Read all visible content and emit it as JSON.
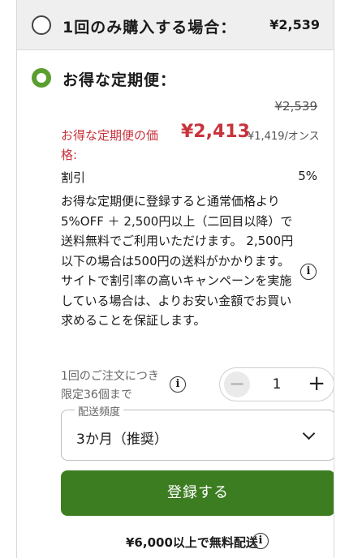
{
  "one_time": {
    "label": "1回のみ購入する場合：",
    "price": "¥2,539"
  },
  "subscription": {
    "label": "お得な定期便：",
    "original_price": "¥2,539",
    "price_label": "お得な定期便の価格:",
    "price": "¥2,413",
    "unit_price": "¥1,419/オンス",
    "discount_label": "割引",
    "discount_value": "5%",
    "description": "お得な定期便に登録すると通常価格より5%OFF ＋ 2,500円以上（二回目以降）で送料無料でご利用いただけます。 2,500円以下の場合は500円の送料がかかります。サイトで割引率の高いキャンペーンを実施している場合は、よりお安い金額でお買い求めることを保証します。"
  },
  "quantity": {
    "limit_text": "1回のご注文につき限定36個まで",
    "value": "1",
    "minus": "−",
    "plus": "+"
  },
  "frequency": {
    "legend": "配送頻度",
    "selected": "3か月（推奨）"
  },
  "register_button": "登録する",
  "free_shipping": "¥6,000以上で無料配送",
  "icons": {
    "info": "i"
  },
  "colors": {
    "accent_green": "#3d7d22",
    "radio_green": "#5a9e2f",
    "price_red": "#c7333c"
  }
}
